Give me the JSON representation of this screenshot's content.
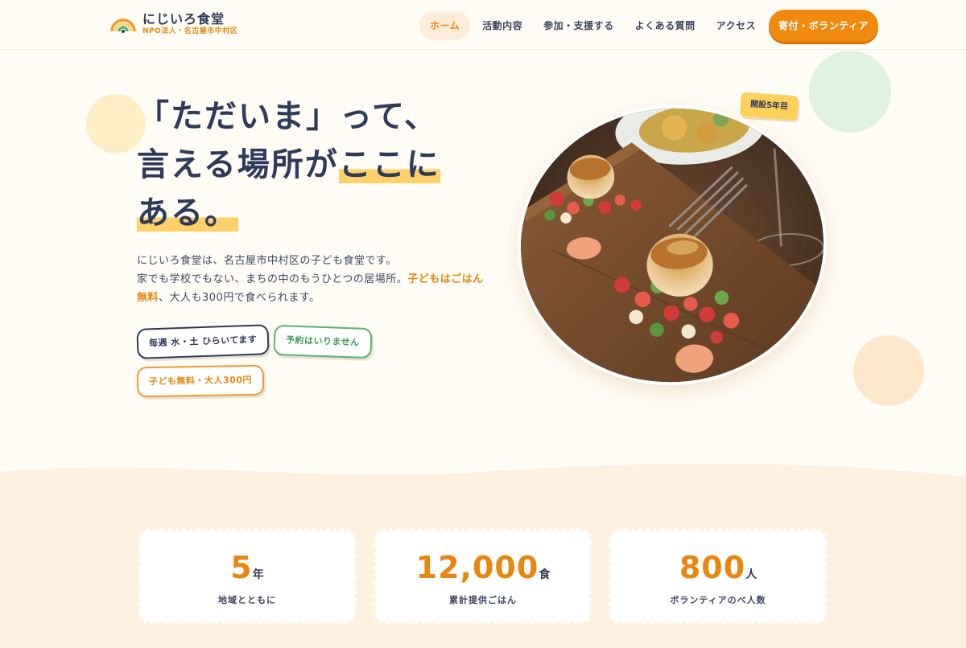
{
  "brand": {
    "name": "にじいろ食堂",
    "subtitle": "NPO法人・名古屋市中村区",
    "colors": {
      "accent": "#e8860f",
      "navy": "#2e3a5a",
      "green": "#5bb26c",
      "yellow": "#fdd06a",
      "background": "#fffcf6"
    }
  },
  "nav": {
    "items": [
      {
        "label": "ホーム",
        "active": true
      },
      {
        "label": "活動内容"
      },
      {
        "label": "参加・支援する"
      },
      {
        "label": "よくある質問"
      },
      {
        "label": "アクセス"
      }
    ],
    "cta": "寄付・ボランティア"
  },
  "hero": {
    "title": {
      "line1": "「ただいま」って、",
      "line2_plain": "言える場所が",
      "line2_highlight": "ここに",
      "line3_highlight": "ある。"
    },
    "description": {
      "line1": "にじいろ食堂は、名古屋市中村区の子ども食堂です。",
      "line2_plain": "家でも学校でもない、まちの中のもうひとつの居場所。",
      "line2_emphasis_a": "子どもはごはん",
      "line3_emphasis_b": "無料",
      "line3_plain": "、大人も300円で食べられます。"
    },
    "tags": [
      "毎週 水・土 ひらいてます",
      "予約はいりません",
      "子ども無料・大人300円"
    ],
    "badge": "開設5年目",
    "photo_icon": "scallop-dish-photo"
  },
  "stats": [
    {
      "number": "5",
      "unit": "年",
      "label": "地域とともに"
    },
    {
      "number": "12,000",
      "unit": "食",
      "label": "累計提供ごはん"
    },
    {
      "number": "800",
      "unit": "人",
      "label": "ボランティアのべ人数"
    }
  ]
}
